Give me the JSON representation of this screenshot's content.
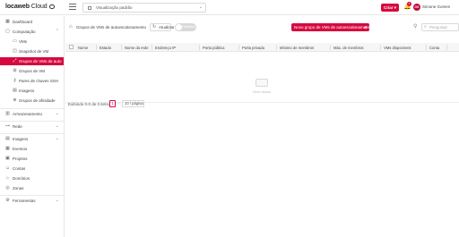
{
  "header": {
    "logo_text": "locaweb",
    "logo_suffix": "Cloud",
    "project": "Visualização padrão",
    "create_label": "Criar",
    "notification_count": "2",
    "avatar_initials": "GG",
    "user_name": "Simone Gomes"
  },
  "sidebar": {
    "items": [
      {
        "label": "Dashboard",
        "icon": "dashboard-icon"
      },
      {
        "label": "Computação",
        "icon": "computer-icon",
        "arrow": "⌃"
      },
      {
        "label": "VMs"
      },
      {
        "label": "Snapshot de VM"
      },
      {
        "label": "Grupos de VMs de auto",
        "icon": "scale-icon"
      },
      {
        "label": "Grupos de VM"
      },
      {
        "label": "Pares de chaves SSH"
      },
      {
        "label": "Imagens"
      },
      {
        "label": "Grupos de afinidade"
      },
      {
        "label": "Armazenamento",
        "arrow": "⌄"
      },
      {
        "label": "Rede",
        "arrow": "⌄"
      },
      {
        "label": "Imagens",
        "arrow": "⌄"
      },
      {
        "label": "Eventos"
      },
      {
        "label": "Projetos"
      },
      {
        "label": "Contas"
      },
      {
        "label": "Domínios"
      },
      {
        "label": "Zonas"
      },
      {
        "label": "Ferramentas",
        "arrow": "⌄"
      }
    ]
  },
  "toolbar": {
    "breadcrumb": "Grupos de VMs de autoescalonamento",
    "refresh_label": "Atualizar",
    "toggle_label": "Detalhes",
    "new_group_label": "Novo grupo de VMs de autoescalonamento",
    "search_placeholder": "Pesquisar"
  },
  "table": {
    "columns": [
      "Nome",
      "Estado",
      "Nome da rede",
      "Endereço IP",
      "Porta pública",
      "Porta privada",
      "Mínimo de membros",
      "Máx. de membros",
      "VMs disponíveis",
      "Conta"
    ],
    "empty_text": "Sem dados"
  },
  "pagination": {
    "total": "Exibindo 0-0 de 0 itens",
    "current": "1",
    "page_size": "10 / página"
  }
}
